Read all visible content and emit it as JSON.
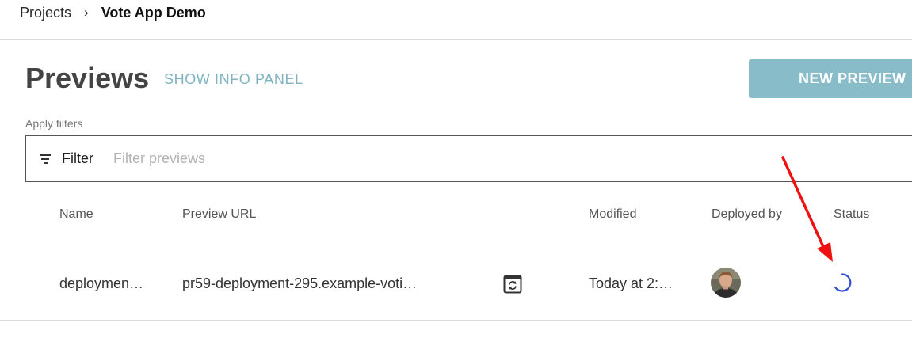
{
  "breadcrumb": {
    "parent": "Projects",
    "separator": "›",
    "current": "Vote App Demo"
  },
  "header": {
    "title": "Previews",
    "info_link": "SHOW INFO PANEL",
    "new_button": "NEW PREVIEW"
  },
  "filters": {
    "label": "Apply filters",
    "filter_label": "Filter",
    "placeholder": "Filter previews",
    "value": ""
  },
  "table": {
    "columns": [
      "Name",
      "Preview URL",
      "Modified",
      "Deployed by",
      "Status"
    ],
    "rows": [
      {
        "name": "deploymen…",
        "url": "pr59-deployment-295.example-voti…",
        "modified": "Today at 2:…",
        "status": "loading"
      }
    ]
  },
  "icons": {
    "filter": "filter-lines-icon",
    "open_url": "browser-refresh-icon",
    "status": "loading-spinner-icon"
  },
  "colors": {
    "accent": "#88bcc8",
    "link": "#7fb3c1",
    "spinner": "#2f4fd8",
    "annotation_arrow": "#ee1111"
  }
}
